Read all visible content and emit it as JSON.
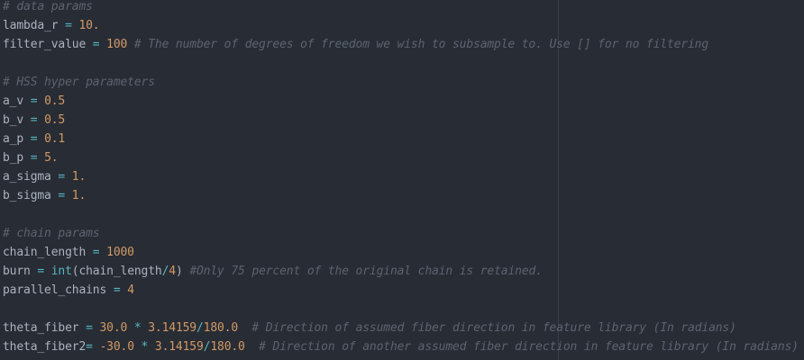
{
  "colors": {
    "background": "#282c34",
    "text": "#abb2bf",
    "operator": "#56b6c2",
    "number": "#d19a66",
    "comment": "#5c6370",
    "ruler": "#3a3f4b"
  },
  "lines": [
    [
      {
        "t": "cm",
        "v": "# data params"
      }
    ],
    [
      {
        "t": "var",
        "v": "lambda_r"
      },
      {
        "t": "op",
        "v": " = "
      },
      {
        "t": "num",
        "v": "10."
      }
    ],
    [
      {
        "t": "var",
        "v": "filter_value"
      },
      {
        "t": "op",
        "v": " = "
      },
      {
        "t": "num",
        "v": "100"
      },
      {
        "t": "cm",
        "v": " # The number of degrees of freedom we wish to subsample to. Use [] for no filtering"
      }
    ],
    [],
    [
      {
        "t": "cm",
        "v": "# HSS hyper parameters"
      }
    ],
    [
      {
        "t": "var",
        "v": "a_v"
      },
      {
        "t": "op",
        "v": " = "
      },
      {
        "t": "num",
        "v": "0.5"
      }
    ],
    [
      {
        "t": "var",
        "v": "b_v"
      },
      {
        "t": "op",
        "v": " = "
      },
      {
        "t": "num",
        "v": "0.5"
      }
    ],
    [
      {
        "t": "var",
        "v": "a_p"
      },
      {
        "t": "op",
        "v": " = "
      },
      {
        "t": "num",
        "v": "0.1"
      }
    ],
    [
      {
        "t": "var",
        "v": "b_p"
      },
      {
        "t": "op",
        "v": " = "
      },
      {
        "t": "num",
        "v": "5."
      }
    ],
    [
      {
        "t": "var",
        "v": "a_sigma"
      },
      {
        "t": "op",
        "v": " = "
      },
      {
        "t": "num",
        "v": "1."
      }
    ],
    [
      {
        "t": "var",
        "v": "b_sigma"
      },
      {
        "t": "op",
        "v": " = "
      },
      {
        "t": "num",
        "v": "1."
      }
    ],
    [],
    [
      {
        "t": "cm",
        "v": "# chain params"
      }
    ],
    [
      {
        "t": "var",
        "v": "chain_length"
      },
      {
        "t": "op",
        "v": " = "
      },
      {
        "t": "num",
        "v": "1000"
      }
    ],
    [
      {
        "t": "var",
        "v": "burn"
      },
      {
        "t": "op",
        "v": " = "
      },
      {
        "t": "fn",
        "v": "int"
      },
      {
        "t": "var",
        "v": "(chain_length"
      },
      {
        "t": "op",
        "v": "/"
      },
      {
        "t": "num",
        "v": "4"
      },
      {
        "t": "var",
        "v": ")"
      },
      {
        "t": "cm",
        "v": " #Only 75 percent of the original chain is retained."
      }
    ],
    [
      {
        "t": "var",
        "v": "parallel_chains"
      },
      {
        "t": "op",
        "v": " = "
      },
      {
        "t": "num",
        "v": "4"
      }
    ],
    [],
    [
      {
        "t": "var",
        "v": "theta_fiber"
      },
      {
        "t": "op",
        "v": " = "
      },
      {
        "t": "num",
        "v": "30.0"
      },
      {
        "t": "op",
        "v": " * "
      },
      {
        "t": "num",
        "v": "3.14159"
      },
      {
        "t": "op",
        "v": "/"
      },
      {
        "t": "num",
        "v": "180.0"
      },
      {
        "t": "cm",
        "v": "  # Direction of assumed fiber direction in feature library (In radians)"
      }
    ],
    [
      {
        "t": "var",
        "v": "theta_fiber2"
      },
      {
        "t": "op",
        "v": "= "
      },
      {
        "t": "num",
        "v": "-30.0"
      },
      {
        "t": "op",
        "v": " * "
      },
      {
        "t": "num",
        "v": "3.14159"
      },
      {
        "t": "op",
        "v": "/"
      },
      {
        "t": "num",
        "v": "180.0"
      },
      {
        "t": "cm",
        "v": "  # Direction of another assumed fiber direction in feature library (In radians)"
      }
    ]
  ]
}
